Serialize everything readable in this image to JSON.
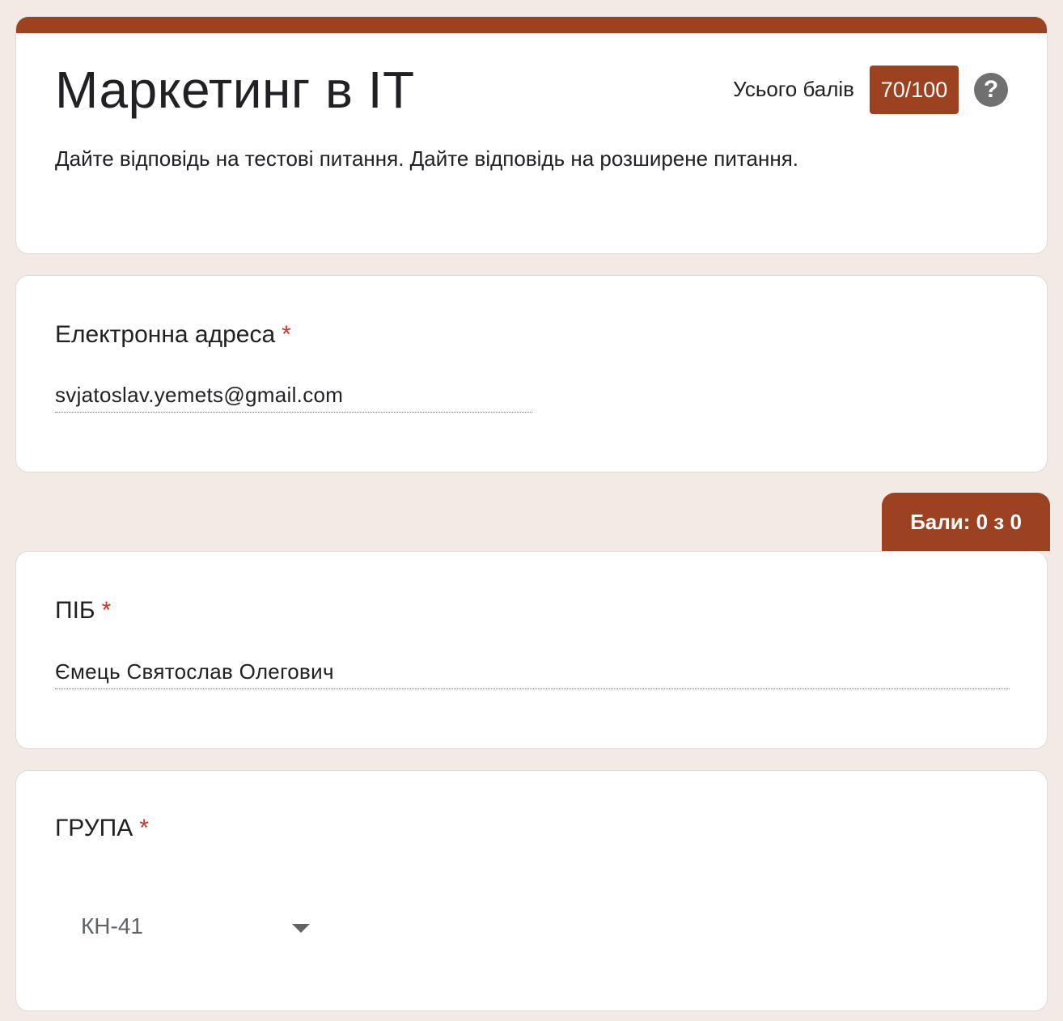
{
  "form": {
    "title": "Маркетинг в IT",
    "score_label": "Усього балів",
    "score_value": "70/100",
    "help_icon_glyph": "?",
    "description": "Дайте відповідь на тестові питання. Дайте відповідь на розширене питання.",
    "accent_color": "#9c4221",
    "background_color": "#f4eae5"
  },
  "email_question": {
    "title": "Електронна адреса",
    "required_mark": "*",
    "answer": "svjatoslav.yemets@gmail.com"
  },
  "points_tab": {
    "label": "Бали: 0 з 0"
  },
  "name_question": {
    "title": "ПІБ",
    "required_mark": "*",
    "answer": "Ємець Святослав Олегович"
  },
  "group_question": {
    "title": "ГРУПА",
    "required_mark": "*",
    "selected_value": "КН-41",
    "caret_icon": "caret-down-icon"
  }
}
